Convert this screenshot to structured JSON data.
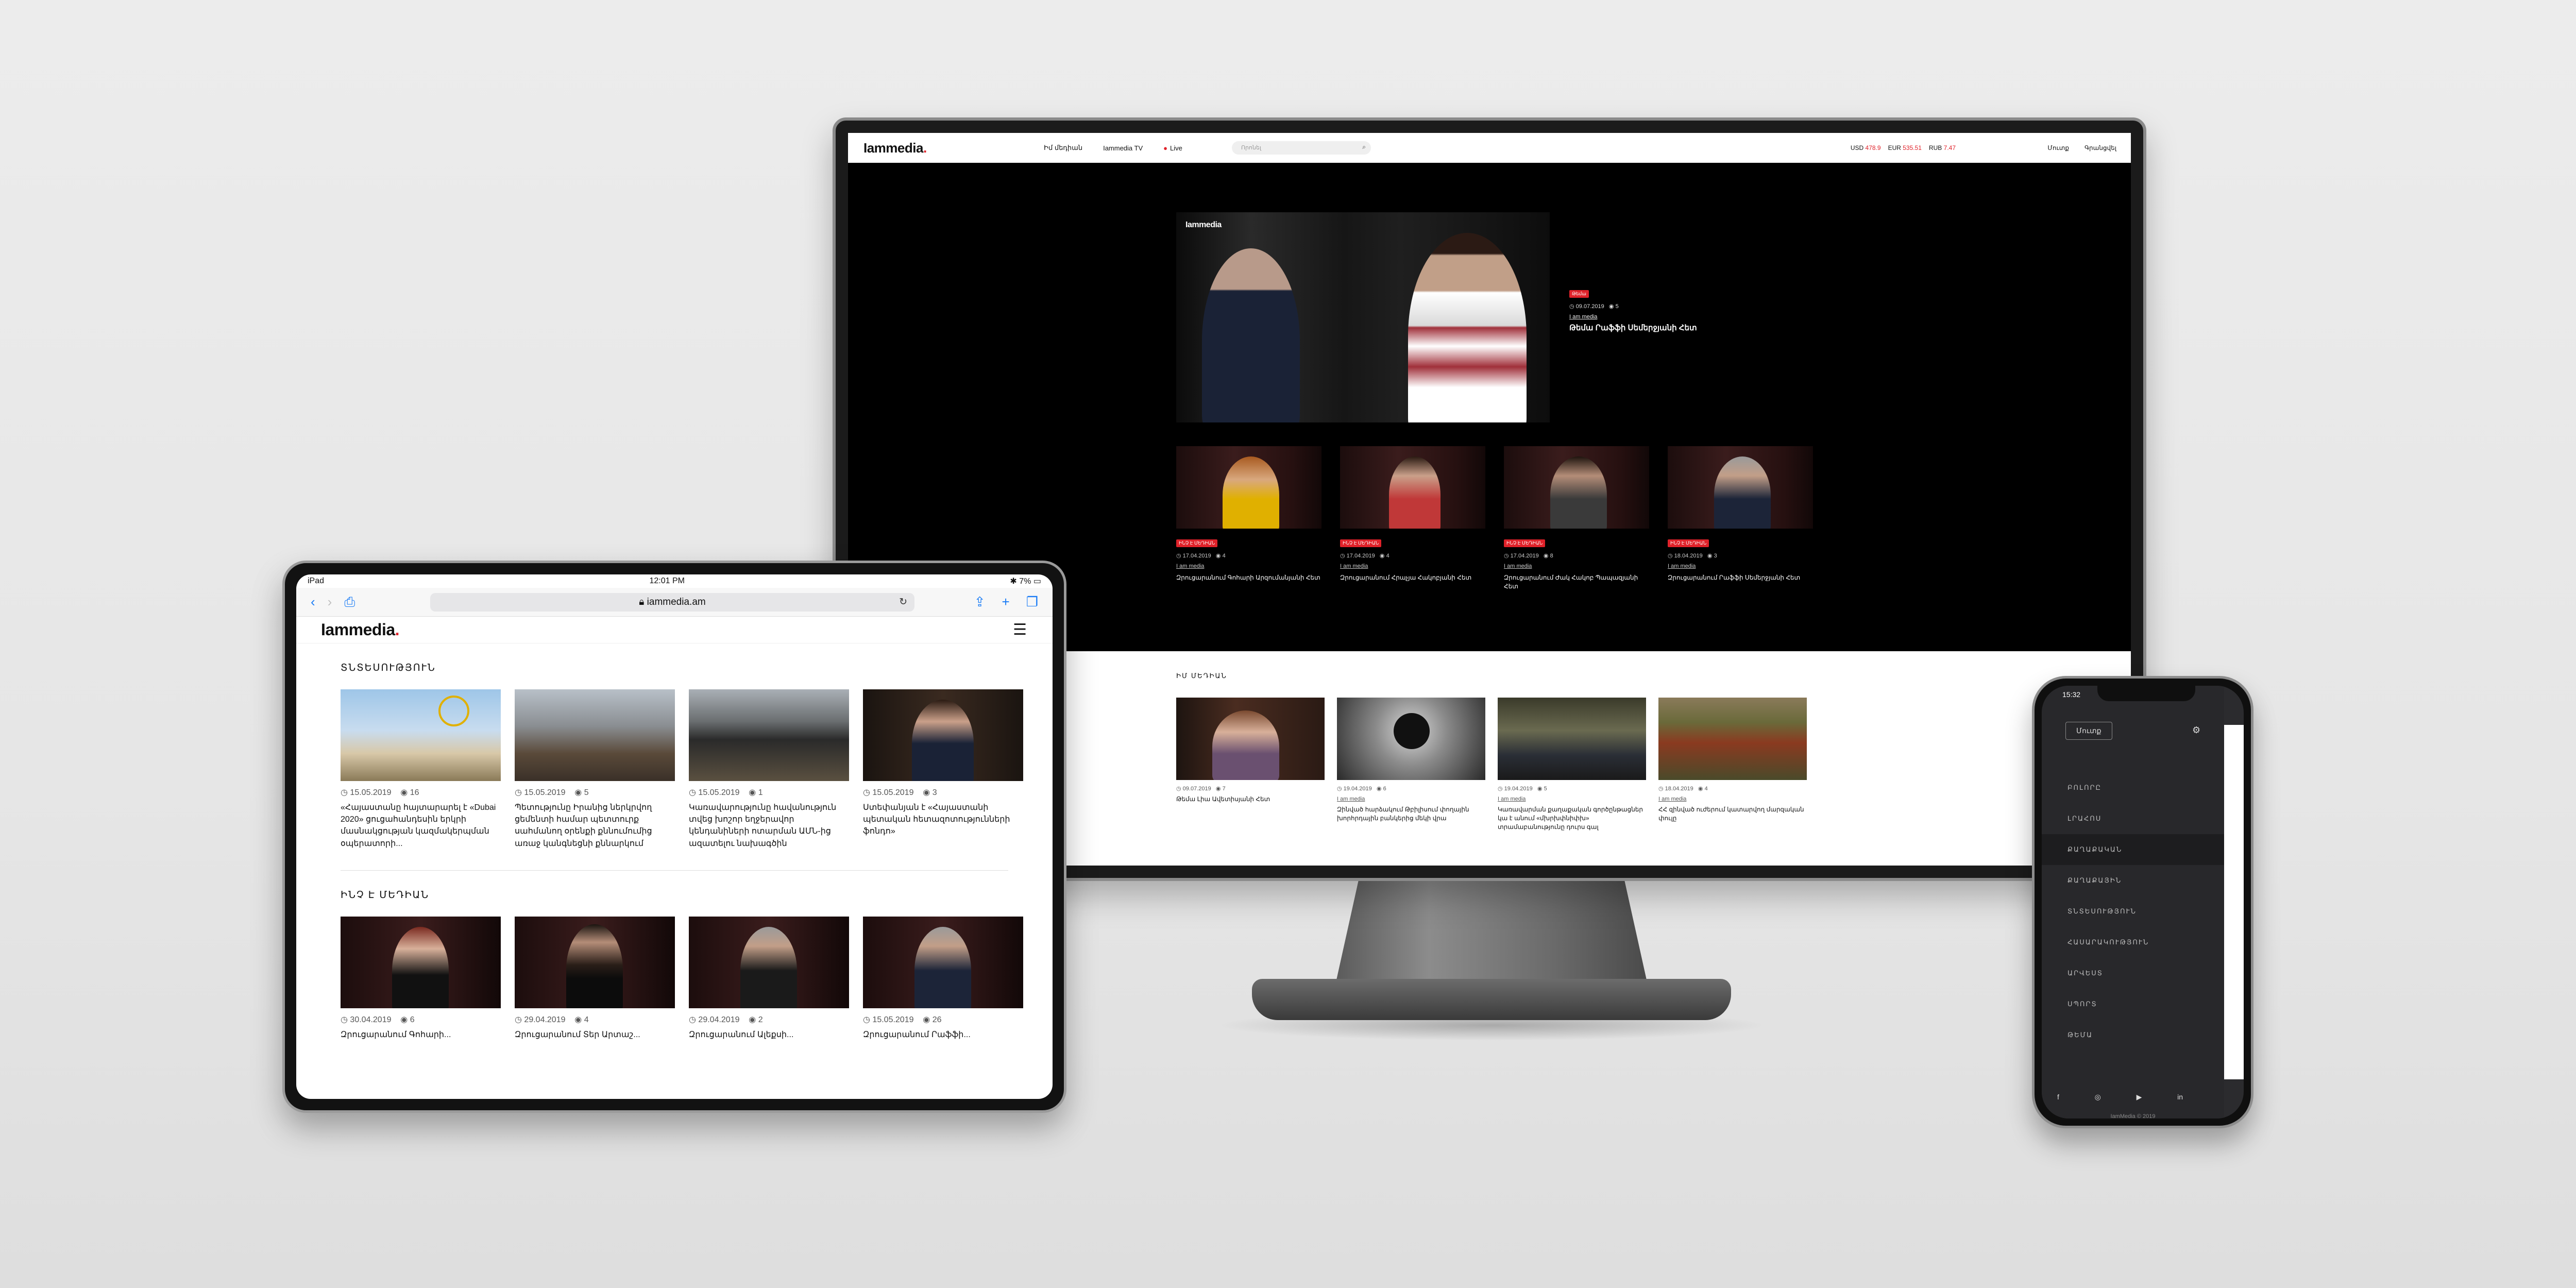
{
  "monitor": {
    "logo": "Iammedia",
    "nav": [
      "Իմ մեդիան",
      "Iammedia TV",
      "Live"
    ],
    "search_placeholder": "Որոնել",
    "rates": {
      "usd_label": "USD",
      "usd": "478.9",
      "eur_label": "EUR",
      "eur": "535.51",
      "rub_label": "RUB",
      "rub": "7.47"
    },
    "auth": {
      "login": "Մուտք",
      "register": "Գրանցվել"
    },
    "hero": {
      "logo": "Iammedia",
      "tag": "Թեմա",
      "date": "09.07.2019",
      "views": "5",
      "author": "I am media",
      "title": "Թեմա Րաֆֆի Սեմերջյանի Հետ"
    },
    "cards": [
      {
        "tag": "ԻՆՉ Է ՄԵԴԻԱՆ",
        "date": "17.04.2019",
        "views": "4",
        "author": "I am media",
        "title": "Զրուցարանում Գոհարի Արզումանյանի Հետ"
      },
      {
        "tag": "ԻՆՉ Է ՄԵԴԻԱՆ",
        "date": "17.04.2019",
        "views": "4",
        "author": "I am media",
        "title": "Զրուցարանում Հրաչյա Հակոբյանի Հետ"
      },
      {
        "tag": "ԻՆՉ Է ՄԵԴԻԱՆ",
        "date": "17.04.2019",
        "views": "8",
        "author": "I am media",
        "title": "Զրուցարանում Ժակ Հակոբ Պապազյանի Հետ"
      },
      {
        "tag": "ԻՆՉ Է ՄԵԴԻԱՆ",
        "date": "18.04.2019",
        "views": "3",
        "author": "I am media",
        "title": "Զրուցարանում Րաֆֆի Սեմերջյանի Հետ"
      }
    ],
    "section_title": "ԻՄ ՄԵԴԻԱՆ",
    "cards2": [
      {
        "date": "09.07.2019",
        "views": "7",
        "author": "",
        "title": "Թեմա Լիա Ավետիսյանի Հետ"
      },
      {
        "date": "19.04.2019",
        "views": "6",
        "author": "I am media",
        "title": "Զինված հարձակում Թբիլիսում փողային խորհրդային բանկերից մեկի վրա"
      },
      {
        "date": "19.04.2019",
        "views": "5",
        "author": "I am media",
        "title": "Կառավարման քաղաքական գործընթացներ կա է անում «մխրխփնիփխ» տրամաբանությունը դուրս գալ"
      },
      {
        "date": "18.04.2019",
        "views": "4",
        "author": "I am media",
        "title": "ՀՀ զինված ուժերում կատարվող մարզական փուլը"
      }
    ]
  },
  "tablet": {
    "status_left": "iPad",
    "status_time": "12:01 PM",
    "status_right": "7%",
    "url": "iammedia.am",
    "logo": "Iammedia",
    "section1": "ՏՆՏԵՍՈՒԹՅՈՒՆ",
    "cards1": [
      {
        "date": "15.05.2019",
        "views": "16",
        "title": "«Հայաստանը հայտարարել է «Dubai 2020» ցուցահանդեսին երկրի մասնակցության կազմակերպման օպերատորի..."
      },
      {
        "date": "15.05.2019",
        "views": "5",
        "title": "Պետությունը Իրանից ներկրվող ցեմենտի համար պետտուրք սահմանող օրենքի քննումումից առաջ կանգնեցնի քննարկում"
      },
      {
        "date": "15.05.2019",
        "views": "1",
        "title": "Կառավարությունը հավանություն տվեց խոշոր եղջերավոր կենդանիների ոտարման ԱՄՆ-ից ազատելու նախագծին"
      },
      {
        "date": "15.05.2019",
        "views": "3",
        "title": "Ստեփանյան է «Հայաստանի պետական հետազոտությունների ֆոնդո»"
      }
    ],
    "section2": "ԻՆՉ Է ՄԵԴԻԱՆ",
    "cards2": [
      {
        "date": "30.04.2019",
        "views": "6",
        "title": "Զրուցարանում Գոհարի..."
      },
      {
        "date": "29.04.2019",
        "views": "4",
        "title": "Զրուցարանում Տեր Արտաշ..."
      },
      {
        "date": "29.04.2019",
        "views": "2",
        "title": "Զրուցարանում Ալեքսի..."
      },
      {
        "date": "15.05.2019",
        "views": "26",
        "title": "Զրուցարանում Րաֆֆի..."
      }
    ]
  },
  "phone": {
    "time": "15:32",
    "login": "Մուտք",
    "menu": [
      "ԲՈԼՈՐԸ",
      "ԼՐԱՀՈՍ",
      "ՔԱՂԱՔԱԿԱՆ",
      "ՔԱՂԱՔԱՅԻՆ",
      "ՏՆՏԵՍՈՒԹՅՈՒՆ",
      "ՀԱՍԱՐԱԿՈՒԹՅՈՒՆ",
      "ԱՐՎԵՍՏ",
      "ՍՊՈՐՏ",
      "ԹԵՄԱ"
    ],
    "active_index": 2,
    "copyright": "IamMedia © 2019"
  },
  "colors": {
    "accent": "#e0222a",
    "dark": "#000000",
    "menu_bg": "#28282b"
  }
}
